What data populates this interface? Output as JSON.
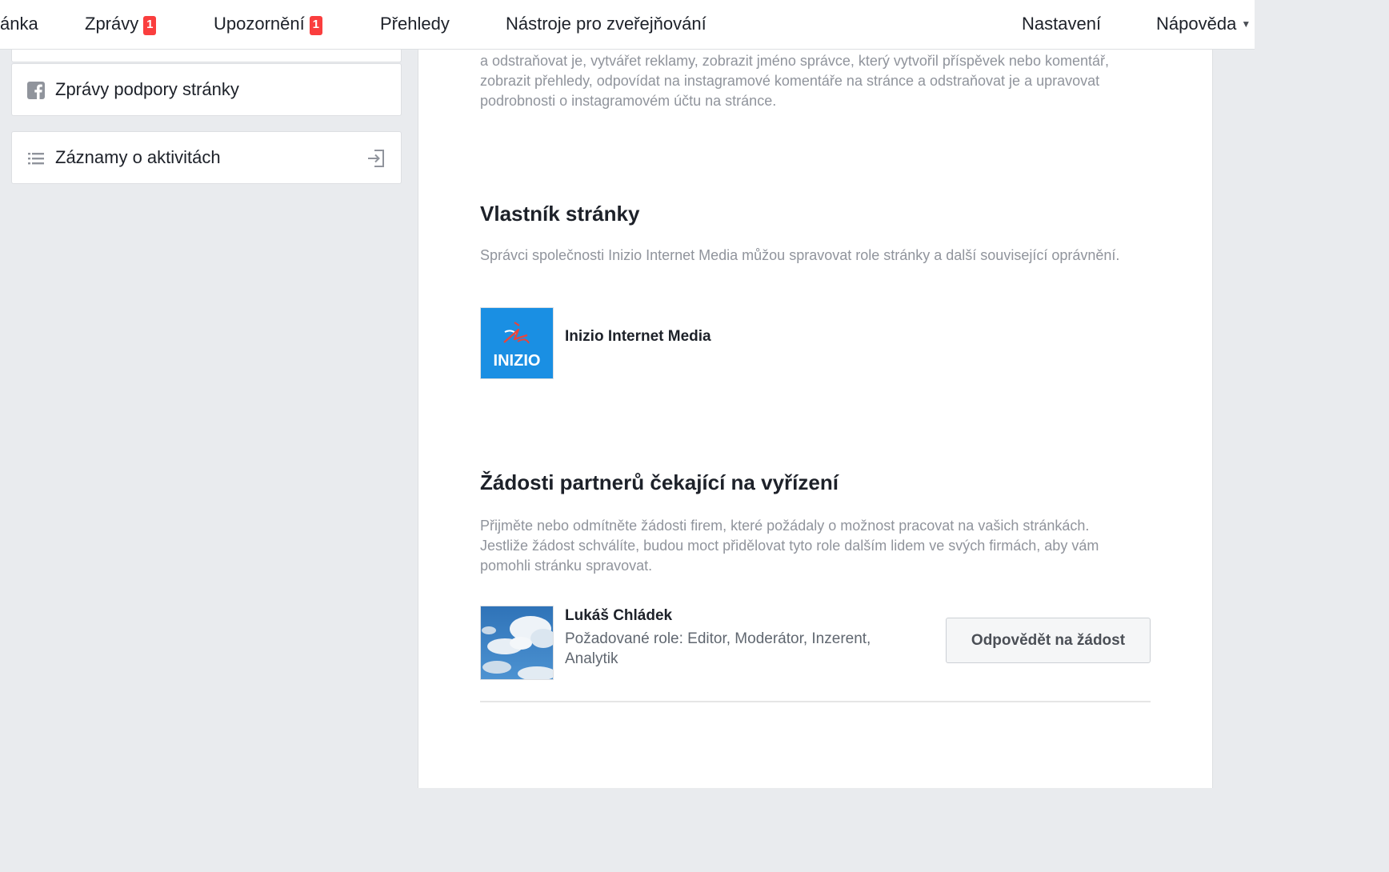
{
  "nav": {
    "page_partial": "ánka",
    "messages": "Zprávy",
    "messages_badge": "1",
    "notifications": "Upozornění",
    "notifications_badge": "1",
    "insights": "Přehledy",
    "publishing_tools": "Nástroje pro zveřejňování",
    "settings": "Nastavení",
    "help": "Nápověda"
  },
  "sidebar": {
    "items": [
      {
        "label": "Zprávy podpory stránky",
        "icon": "facebook-icon"
      },
      {
        "label": "Záznamy o aktivitách",
        "icon": "list-icon",
        "right_icon": "exit-icon"
      }
    ]
  },
  "main": {
    "intro_text": "a odstraňovat je, vytvářet reklamy, zobrazit jméno správce, který vytvořil příspěvek nebo komentář, zobrazit přehledy, odpovídat na instagramové komentáře na stránce a odstraňovat je a upravovat podrobnosti o instagramovém účtu na stránce.",
    "owner_section": {
      "title": "Vlastník stránky",
      "description": "Správci společnosti Inizio Internet Media můžou spravovat role stránky a další související oprávnění.",
      "owner_name": "Inizio Internet Media",
      "logo_text": "INIZIO"
    },
    "requests_section": {
      "title": "Žádosti partnerů čekající na vyřízení",
      "description": "Přijměte nebo odmítněte žádosti firem, které požádaly o možnost pracovat na vašich stránkách. Jestliže žádost schválíte, budou moct přidělovat tyto role dalším lidem ve svých firmách, aby vám pomohli stránku spravovat.",
      "requests": [
        {
          "name": "Lukáš Chládek",
          "roles": "Požadované role: Editor, Moderátor, Inzerent, Analytik",
          "button_label": "Odpovědět na žádost"
        }
      ]
    }
  },
  "colors": {
    "badge": "#fa3e3e",
    "background": "#e9ebee",
    "inizio_blue": "#1a8fe3",
    "inizio_red": "#e8453c"
  }
}
